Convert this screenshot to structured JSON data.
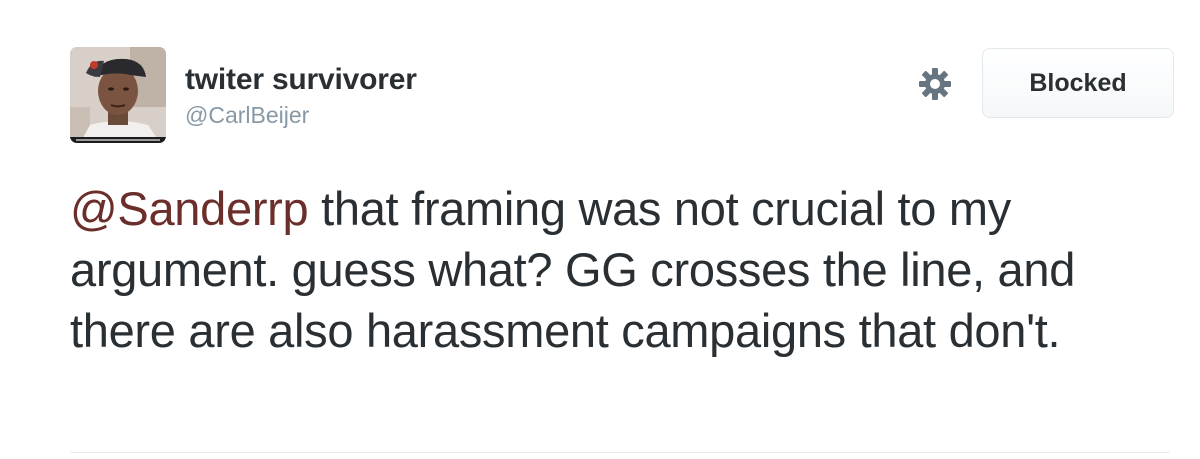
{
  "user": {
    "display_name": "twiter survivorer",
    "handle": "@CarlBeijer"
  },
  "actions": {
    "settings_icon": "gear-icon",
    "blocked_label": "Blocked"
  },
  "tweet": {
    "mention": "@Sanderrp",
    "body": " that framing was not crucial to my argument. guess what? GG crosses the line, and there are also harassment campaigns that don't."
  },
  "colors": {
    "mention": "#6b2e2a",
    "text": "#292f33",
    "handle": "#8899a6"
  }
}
